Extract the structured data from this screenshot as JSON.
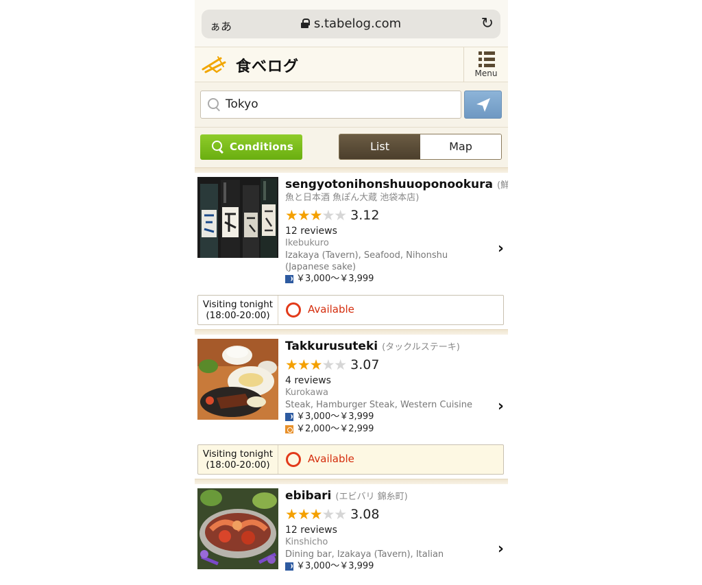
{
  "browser": {
    "text_size_label": "ぁあ",
    "url": "s.tabelog.com",
    "reload_icon": "reload-icon"
  },
  "header": {
    "logo_text": "食べログ",
    "menu_label": "Menu"
  },
  "search": {
    "value": "Tokyo"
  },
  "filters": {
    "conditions_label": "Conditions",
    "list_label": "List",
    "map_label": "Map",
    "active_view": "List"
  },
  "colors": {
    "accent_green": "#7abd1e",
    "star_on": "#f4a000",
    "available_red": "#d42c0c",
    "location_blue": "#7ea6cd"
  },
  "restaurants": [
    {
      "name": "sengyotonihonshuuoponookura",
      "name_jp": "(鮮魚と日本酒 魚ぽん大蔵 池袋本店)",
      "stars_filled": 3,
      "stars_total": 5,
      "score": "3.12",
      "reviews": "12 reviews",
      "area": "Ikebukuro",
      "genre": "Izakaya (Tavern), Seafood, Nihonshu (Japanese sake)",
      "price_dinner": "￥3,000～￥3,999",
      "price_lunch": "",
      "visiting": "Visiting tonight",
      "visiting_time": "(18:00-20:00)",
      "availability": "Available"
    },
    {
      "name": "Takkurusuteki",
      "name_jp": "(タックルステーキ)",
      "stars_filled": 3,
      "stars_total": 5,
      "score": "3.07",
      "reviews": "4 reviews",
      "area": "Kurokawa",
      "genre": "Steak, Hamburger Steak, Western Cuisine",
      "price_dinner": "￥3,000～￥3,999",
      "price_lunch": "￥2,000～￥2,999",
      "visiting": "Visiting tonight",
      "visiting_time": "(18:00-20:00)",
      "availability": "Available"
    },
    {
      "name": "ebibari",
      "name_jp": "(エビバリ 錦糸町)",
      "stars_filled": 3,
      "stars_total": 5,
      "score": "3.08",
      "reviews": "12 reviews",
      "area": "Kinshicho",
      "genre": "Dining bar, Izakaya (Tavern), Italian",
      "price_dinner": "￥3,000～￥3,999",
      "price_lunch": ""
    }
  ]
}
